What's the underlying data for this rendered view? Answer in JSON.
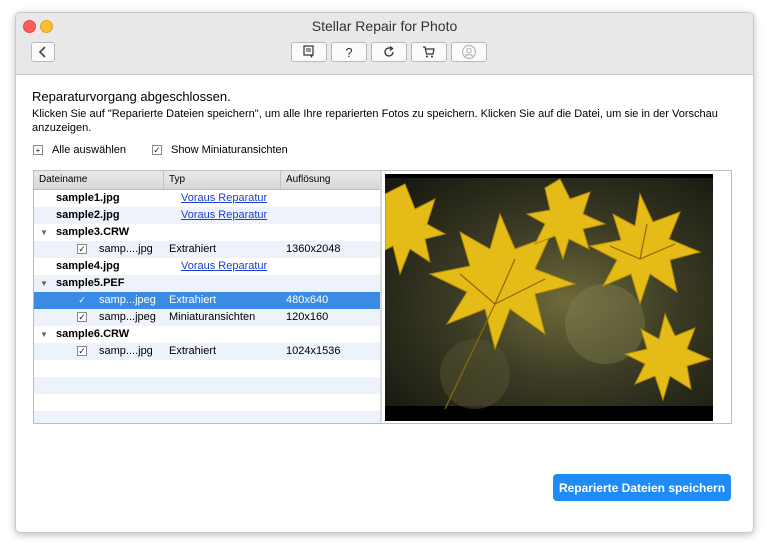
{
  "window": {
    "title": "Stellar Repair for Photo"
  },
  "toolbar": {
    "buttons": [
      {
        "icon": "save-list-icon"
      },
      {
        "icon": "help-icon",
        "label": "?"
      },
      {
        "icon": "refresh-icon"
      },
      {
        "icon": "cart-icon"
      },
      {
        "icon": "account-icon"
      }
    ]
  },
  "content": {
    "heading": "Reparaturvorgang abgeschlossen.",
    "description": "Klicken Sie auf \"Reparierte Dateien speichern\", um alle Ihre reparierten Fotos zu speichern. Klicken Sie auf die Datei, um sie in der Vorschau anzuzeigen.",
    "select_all": "Alle auswählen",
    "show_thumbnails": "Show Miniaturansichten"
  },
  "table": {
    "columns": [
      "Dateiname",
      "Typ",
      "Auflösung"
    ],
    "rows": [
      {
        "name": "sample1.jpg",
        "type": "Voraus Reparatur",
        "resolution": ""
      },
      {
        "name": "sample2.jpg",
        "type": "Voraus Reparatur",
        "resolution": ""
      },
      {
        "name": "sample3.CRW",
        "type": "",
        "resolution": ""
      },
      {
        "name": "samp....jpg",
        "type": "Extrahiert",
        "resolution": "1360x2048"
      },
      {
        "name": "sample4.jpg",
        "type": "Voraus Reparatur",
        "resolution": ""
      },
      {
        "name": "sample5.PEF",
        "type": "",
        "resolution": ""
      },
      {
        "name": "samp...jpeg",
        "type": "Extrahiert",
        "resolution": "480x640"
      },
      {
        "name": "samp...jpeg",
        "type": "Miniaturansichten",
        "resolution": "120x160"
      },
      {
        "name": "sample6.CRW",
        "type": "",
        "resolution": ""
      },
      {
        "name": "samp....jpg",
        "type": "Extrahiert",
        "resolution": "1024x1536"
      }
    ]
  },
  "actions": {
    "save_label": "Reparierte Dateien speichern"
  },
  "colors": {
    "accent": "#1f8cf5",
    "selection": "#3a8ae6",
    "link": "#1a3fd6"
  }
}
